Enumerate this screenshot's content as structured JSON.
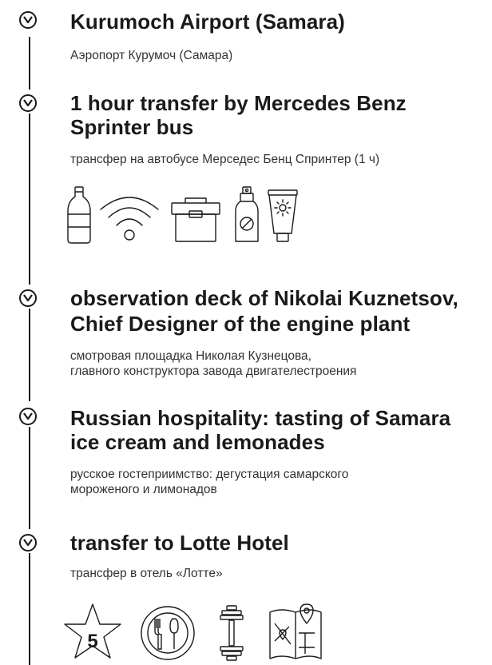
{
  "stops": [
    {
      "title": "Kurumoch Airport (Samara)",
      "subtitle": "Аэропорт Курумоч (Самара)"
    },
    {
      "title_line1": "1 hour transfer by Mercedes Benz",
      "title_line2": "Sprinter bus",
      "subtitle": "трансфер на автобусе Мерседес Бенц Спринтер (1 ч)"
    },
    {
      "title_line1": "observation deck of Nikolai Kuznetsov,",
      "title_line2": "Chief Designer of the engine plant",
      "subtitle_line1": "смотровая площадка Николая Кузнецова,",
      "subtitle_line2": "главного конструктора завода двигателестроения"
    },
    {
      "title_line1": "Russian hospitality: tasting of Samara",
      "title_line2": "ice cream and lemonades",
      "subtitle_line1": "русское гостеприимство: дегустация самарского",
      "subtitle_line2": "мороженого и лимонадов"
    },
    {
      "title": "transfer to Lotte Hotel",
      "subtitle": "трансфер в отель «Лотте»"
    }
  ],
  "transfer_icons": [
    "water-bottle-icon",
    "wifi-icon",
    "cooler-box-icon",
    "spray-bottle-icon",
    "sunscreen-icon"
  ],
  "hotel_icons": [
    {
      "name": "five-star-icon",
      "label": "5"
    },
    {
      "name": "restaurant-icon"
    },
    {
      "name": "gym-dumbbell-icon"
    },
    {
      "name": "city-map-icon"
    }
  ]
}
